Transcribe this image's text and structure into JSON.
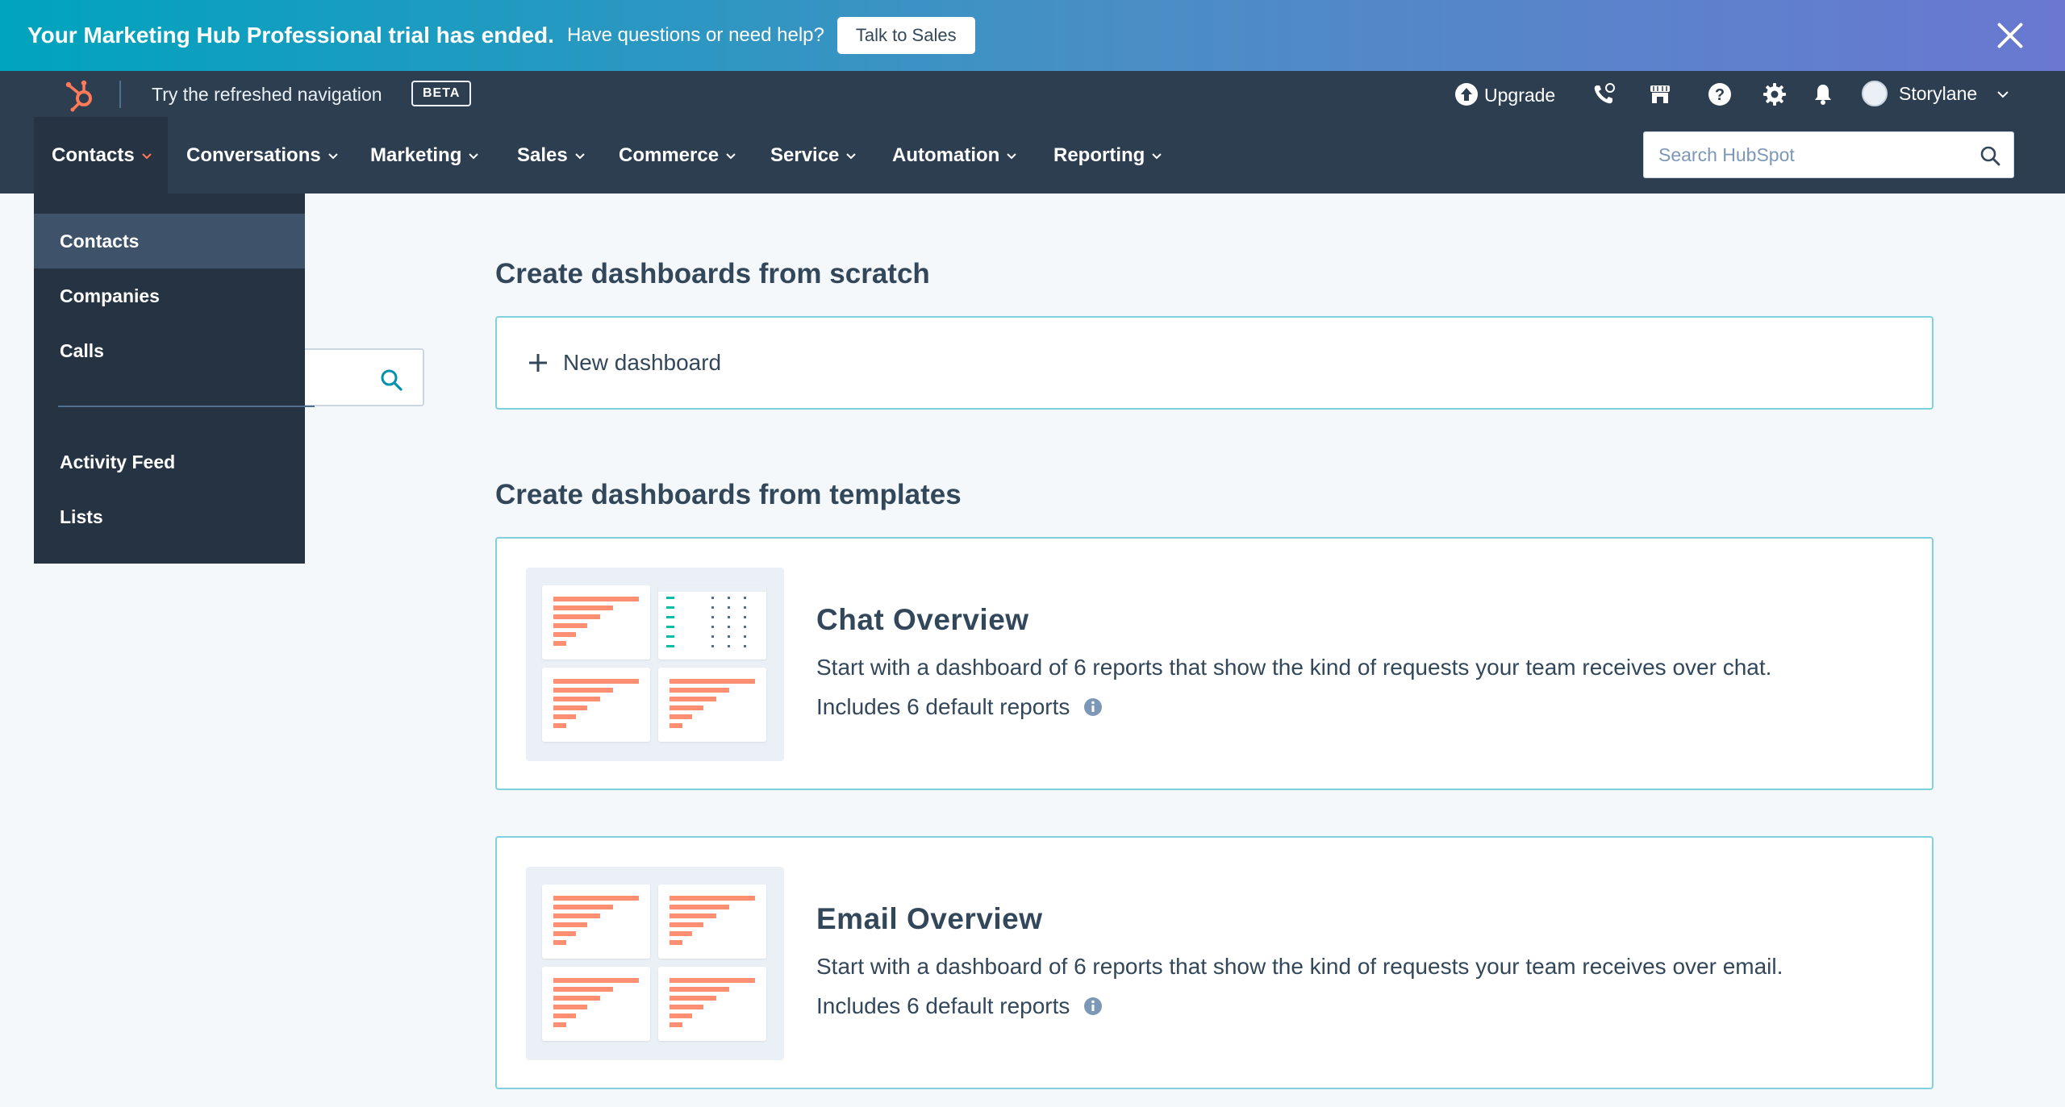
{
  "banner": {
    "title": "Your Marketing Hub Professional trial has ended.",
    "subtitle": "Have questions or need help?",
    "button_label": "Talk to Sales"
  },
  "topbar": {
    "try_nav": "Try the refreshed navigation",
    "beta_badge": "BETA",
    "upgrade_label": "Upgrade",
    "account_name": "Storylane"
  },
  "nav": {
    "items": [
      {
        "label": "Contacts"
      },
      {
        "label": "Conversations"
      },
      {
        "label": "Marketing"
      },
      {
        "label": "Sales"
      },
      {
        "label": "Commerce"
      },
      {
        "label": "Service"
      },
      {
        "label": "Automation"
      },
      {
        "label": "Reporting"
      }
    ],
    "search_placeholder": "Search HubSpot"
  },
  "dropdown": {
    "items": [
      {
        "label": "Contacts"
      },
      {
        "label": "Companies"
      },
      {
        "label": "Calls"
      },
      {
        "label": "Activity Feed"
      },
      {
        "label": "Lists"
      }
    ]
  },
  "main": {
    "scratch_heading": "Create dashboards from scratch",
    "new_dashboard_label": "New dashboard",
    "templates_heading": "Create dashboards from templates",
    "templates": [
      {
        "title": "Chat Overview",
        "description": "Start with a dashboard of 6 reports that show the kind of requests your team receives over chat.",
        "includes": "Includes 6 default reports"
      },
      {
        "title": "Email Overview",
        "description": "Start with a dashboard of 6 reports that show the kind of requests your team receives over email.",
        "includes": "Includes 6 default reports"
      }
    ]
  },
  "colors": {
    "banner_start": "#00a4bd",
    "banner_end": "#6a78d1",
    "nav_bg": "#2d3e50",
    "dropdown_bg": "#253342",
    "accent_teal": "#00a4bd",
    "chart_bar": "#ff8f73",
    "hubspot_orange": "#ff7a59"
  },
  "icons": [
    "close-icon",
    "hubspot-logo",
    "upgrade-icon",
    "phone-icon",
    "marketplace-icon",
    "help-icon",
    "settings-icon",
    "notifications-icon",
    "chevron-down-icon",
    "search-icon",
    "plus-icon",
    "info-icon"
  ]
}
